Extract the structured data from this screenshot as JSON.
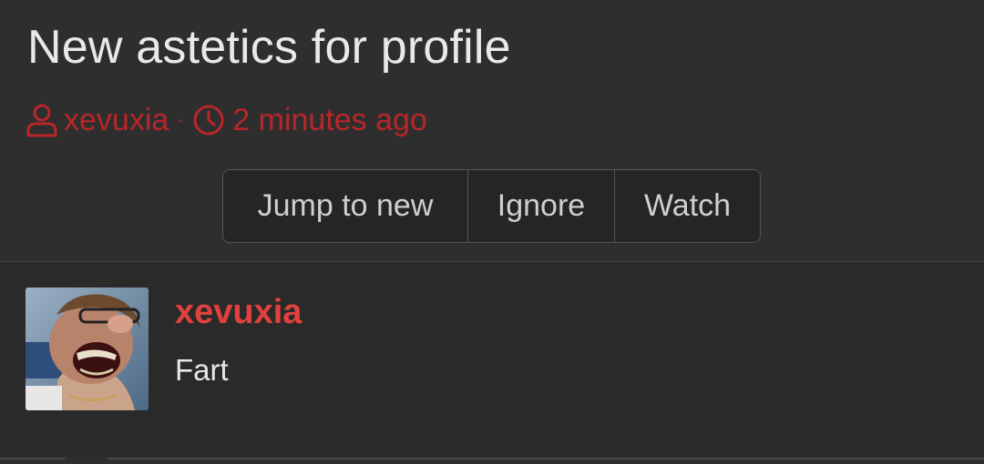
{
  "thread": {
    "title": "New astetics for profile",
    "author": "xevuxia",
    "separator": "·",
    "time": "2 minutes ago"
  },
  "actions": {
    "jump_label": "Jump to new",
    "ignore_label": "Ignore",
    "watch_label": "Watch"
  },
  "post": {
    "author": "xevuxia",
    "body": "Fart"
  },
  "icons": {
    "author": "user-icon",
    "time": "clock-icon"
  },
  "colors": {
    "accent": "#e0413c",
    "meta": "#b8262a",
    "background": "#2e2e2e"
  }
}
